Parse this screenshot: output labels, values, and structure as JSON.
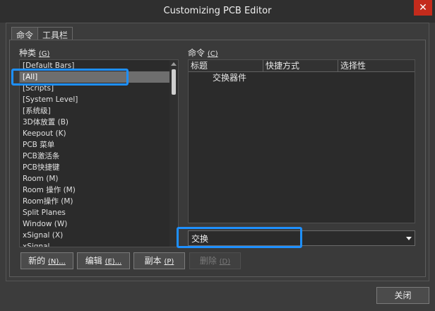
{
  "window": {
    "title": "Customizing PCB Editor",
    "close_glyph": "✕"
  },
  "tabs": [
    {
      "label": "命令",
      "active": true
    },
    {
      "label": "工具栏",
      "active": false
    }
  ],
  "categories": {
    "label": "种类",
    "shortcut": "(G)",
    "items": [
      "[Default Bars]",
      "[All]",
      "[Scripts]",
      "[System Level]",
      "[系统级]",
      "3D体放置 (B)",
      "Keepout (K)",
      "PCB 菜单",
      "PCB激活条",
      "PCB快捷键",
      "Room (M)",
      "Room 操作 (M)",
      "Room操作 (M)",
      "Split Planes",
      "Window (W)",
      "xSignal (X)",
      "xSignal..."
    ],
    "selected_index": 1
  },
  "commands": {
    "label": "命令",
    "shortcut": "(C)",
    "columns": [
      "标题",
      "快捷方式",
      "选择性"
    ],
    "rows": [
      {
        "icon": "",
        "title": "交换器件",
        "shortcut": "",
        "selective": ""
      }
    ]
  },
  "search": {
    "value": "交换"
  },
  "buttons": {
    "new": {
      "label": "新的",
      "key": "(N)..."
    },
    "edit": {
      "label": "编辑",
      "key": "(E)..."
    },
    "copy": {
      "label": "副本",
      "key": "(P)"
    },
    "delete": {
      "label": "删除",
      "key": "(D)"
    },
    "close": {
      "label": "关闭"
    }
  },
  "colors": {
    "highlight": "#1e90ff",
    "selection": "#6e6e6e",
    "close": "#c42b1c"
  }
}
